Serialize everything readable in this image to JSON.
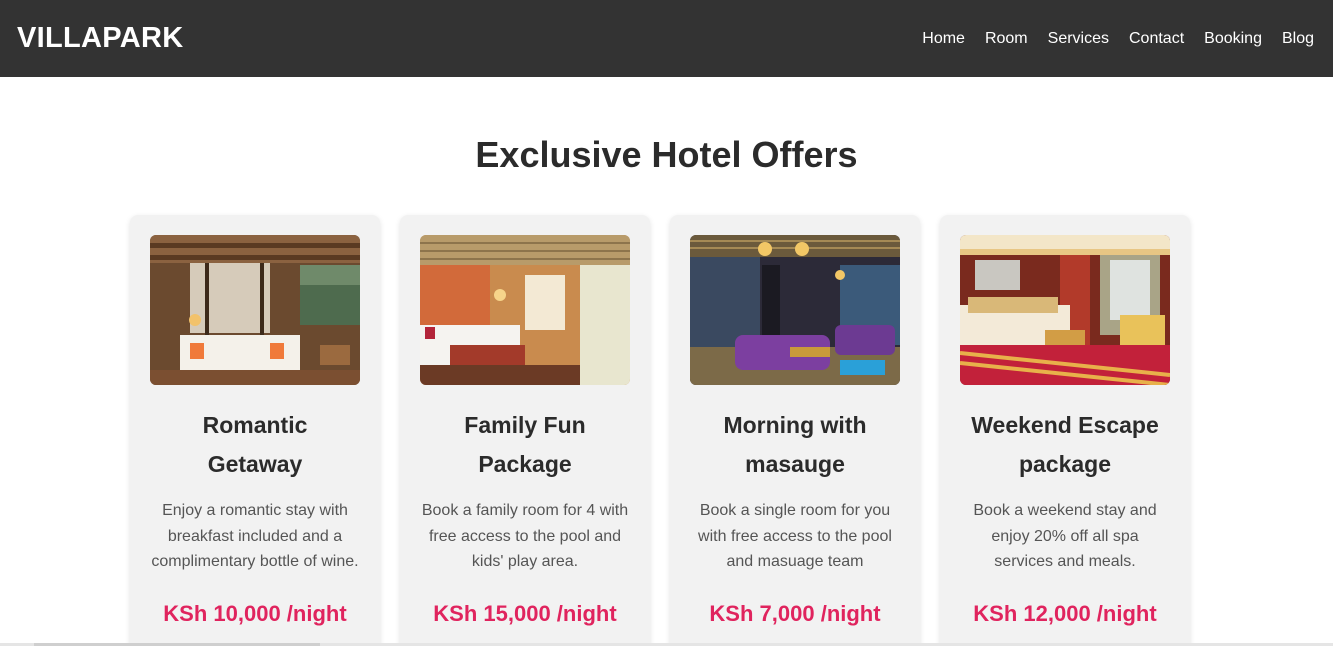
{
  "nav": {
    "brand": "VILLAPARK",
    "links": [
      "Home",
      "Room",
      "Services",
      "Contact",
      "Booking",
      "Blog"
    ]
  },
  "page": {
    "title": "Exclusive Hotel Offers"
  },
  "offers": [
    {
      "title": "Romantic Getaway",
      "description": "Enjoy a romantic stay with breakfast included and a complimentary bottle of wine.",
      "price": "KSh 10,000 /night"
    },
    {
      "title": "Family Fun Package",
      "description": "Book a family room for 4 with free access to the pool and kids' play area.",
      "price": "KSh 15,000 /night"
    },
    {
      "title": "Morning with masauge",
      "description": "Book a single room for you with free access to the pool and masuage team",
      "price": "KSh 7,000 /night"
    },
    {
      "title": "Weekend Escape package",
      "description": "Book a weekend stay and enjoy 20% off all spa services and meals.",
      "price": "KSh 12,000 /night"
    }
  ],
  "colors": {
    "navbar": "#333333",
    "price": "#e0245e",
    "card": "#f2f2f2"
  }
}
